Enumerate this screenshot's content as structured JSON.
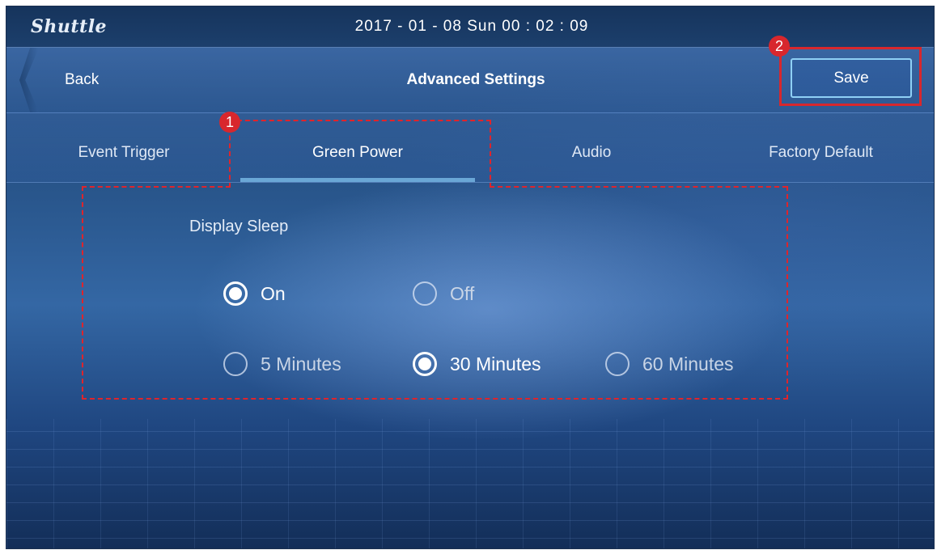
{
  "topbar": {
    "logo": "Shuttle",
    "datetime": "2017 - 01 - 08  Sun  00 : 02 : 09"
  },
  "header": {
    "back_label": "Back",
    "title": "Advanced Settings",
    "save_label": "Save"
  },
  "tabs": [
    {
      "label": "Event Trigger",
      "active": false
    },
    {
      "label": "Green Power",
      "active": true
    },
    {
      "label": "Audio",
      "active": false
    },
    {
      "label": "Factory Default",
      "active": false
    }
  ],
  "display_sleep": {
    "label": "Display Sleep",
    "toggle_options": [
      {
        "label": "On",
        "selected": true
      },
      {
        "label": "Off",
        "selected": false
      }
    ],
    "duration_options": [
      {
        "label": "5 Minutes",
        "selected": false
      },
      {
        "label": "30 Minutes",
        "selected": true
      },
      {
        "label": "60 Minutes",
        "selected": false
      }
    ]
  },
  "annotations": {
    "callout_1": "1",
    "callout_2": "2"
  },
  "colors": {
    "accent_underline": "#6aa7d6",
    "save_border": "#8fd0f5",
    "annotation_red": "#d8272d"
  }
}
